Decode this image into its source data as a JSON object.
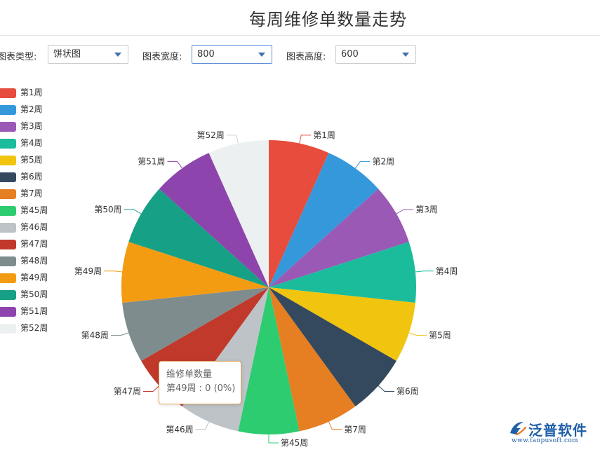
{
  "page": {
    "title": "每周维修单数量走势"
  },
  "controls": {
    "chart_type": {
      "label": "图表类型:",
      "value": "饼状图"
    },
    "chart_width": {
      "label": "图表宽度:",
      "value": "800"
    },
    "chart_height": {
      "label": "图表高度:",
      "value": "600"
    }
  },
  "chart_data": {
    "type": "pie",
    "series_name": "维修单数量",
    "categories": [
      "第1周",
      "第2周",
      "第3周",
      "第4周",
      "第5周",
      "第6周",
      "第7周",
      "第45周",
      "第46周",
      "第47周",
      "第48周",
      "第49周",
      "第50周",
      "第51周",
      "第52周"
    ],
    "values": [
      0,
      0,
      0,
      0,
      0,
      0,
      0,
      0,
      0,
      0,
      0,
      0,
      0,
      0,
      0
    ],
    "colors": [
      "#e74c3c",
      "#3498db",
      "#9b59b6",
      "#1abc9c",
      "#f1c40f",
      "#34495e",
      "#e67e22",
      "#2ecc71",
      "#bdc3c7",
      "#c0392b",
      "#7f8c8d",
      "#f39c12",
      "#16a085",
      "#8e44ad",
      "#ecf0f1"
    ],
    "legend_position": "left"
  },
  "tooltip": {
    "title": "维修单数量",
    "text": "第49周 : 0 (0%)"
  },
  "brand": {
    "name": "泛普软件",
    "url": "www.fanpusoft.com",
    "logo_icon": "fanpu-logo-icon"
  }
}
